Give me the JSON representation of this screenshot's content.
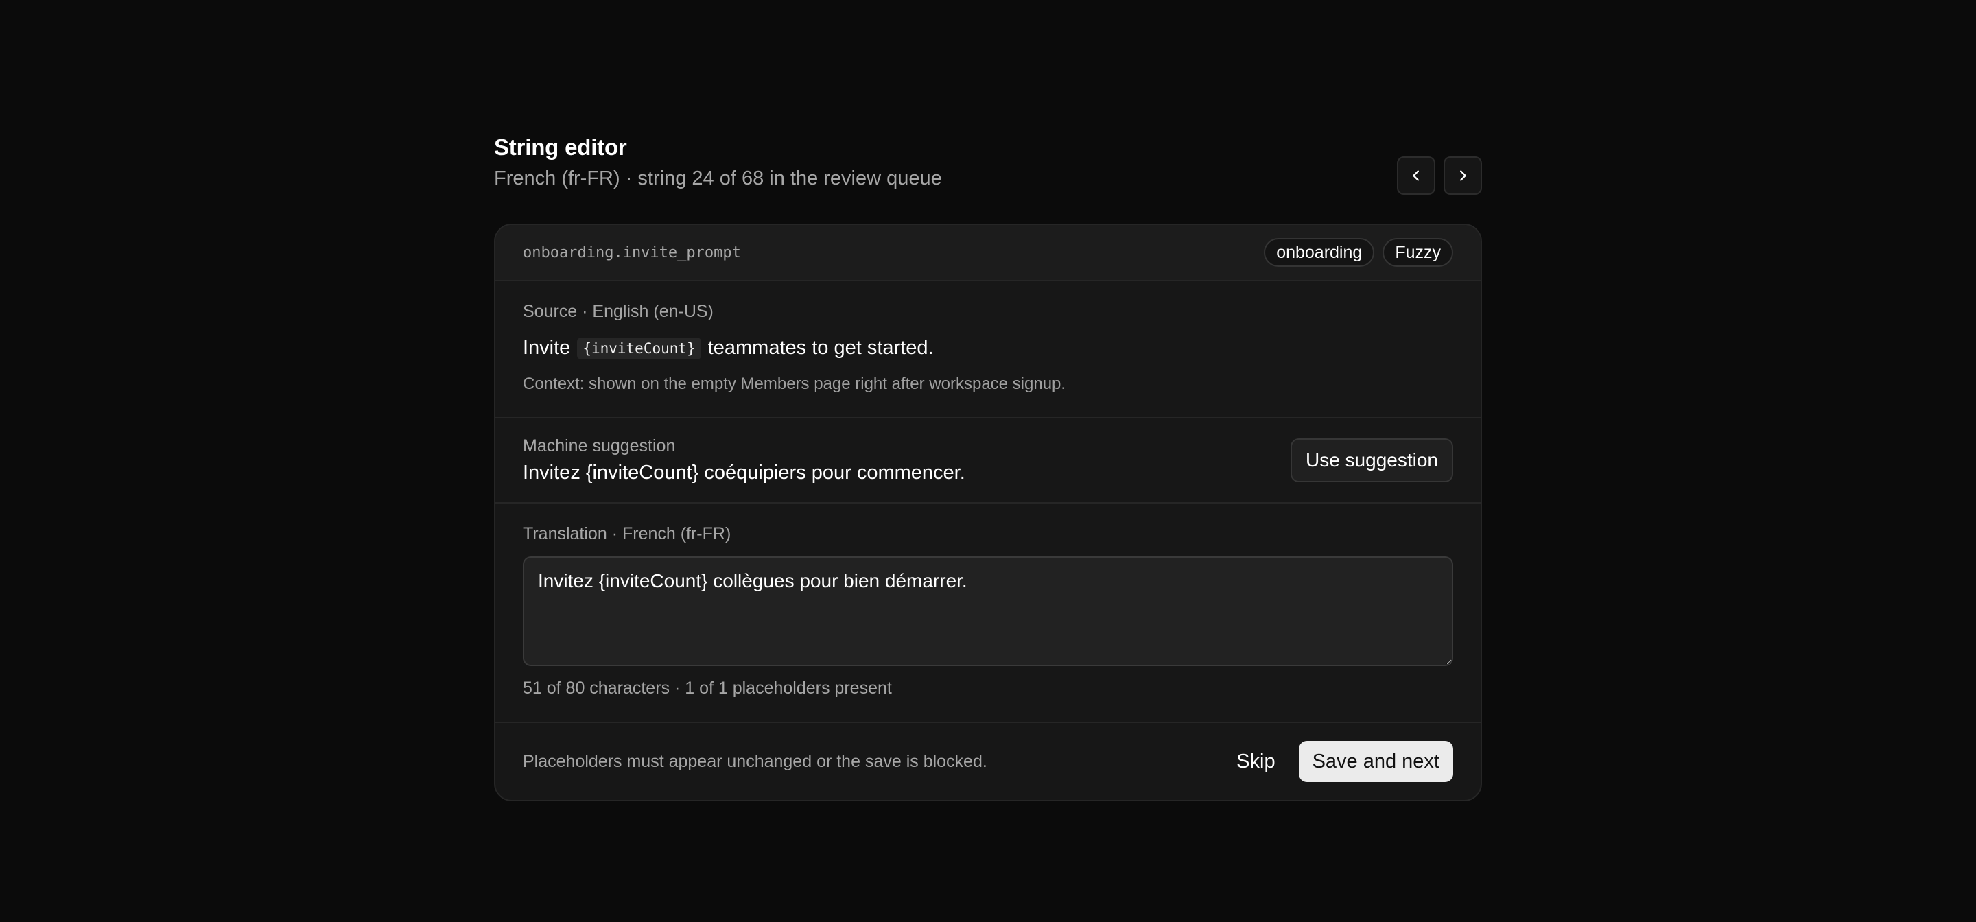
{
  "header": {
    "title": "String editor",
    "subtitle": "French (fr-FR) · string 24 of 68 in the review queue"
  },
  "nav": {
    "prev_icon": "chevron-left-icon",
    "next_icon": "chevron-right-icon"
  },
  "string": {
    "key": "onboarding.invite_prompt",
    "tags": [
      "onboarding",
      "Fuzzy"
    ]
  },
  "source": {
    "label": "Source · English (en-US)",
    "text_before": "Invite",
    "placeholder": "{inviteCount}",
    "text_after": "teammates to get started.",
    "context": "Context: shown on the empty Members page right after workspace signup."
  },
  "suggestion": {
    "label": "Machine suggestion",
    "text": "Invitez {inviteCount} coéquipiers pour commencer.",
    "button_label": "Use suggestion"
  },
  "translation": {
    "label": "Translation · French (fr-FR)",
    "value": "Invitez {inviteCount} collègues pour bien démarrer.",
    "meta": "51 of 80 characters · 1 of 1 placeholders present"
  },
  "footer": {
    "note": "Placeholders must appear unchanged or the save is blocked.",
    "skip_label": "Skip",
    "save_label": "Save and next"
  },
  "colors": {
    "background": "#0b0b0b",
    "card": "#171717",
    "primary_button": "#ebebeb"
  }
}
